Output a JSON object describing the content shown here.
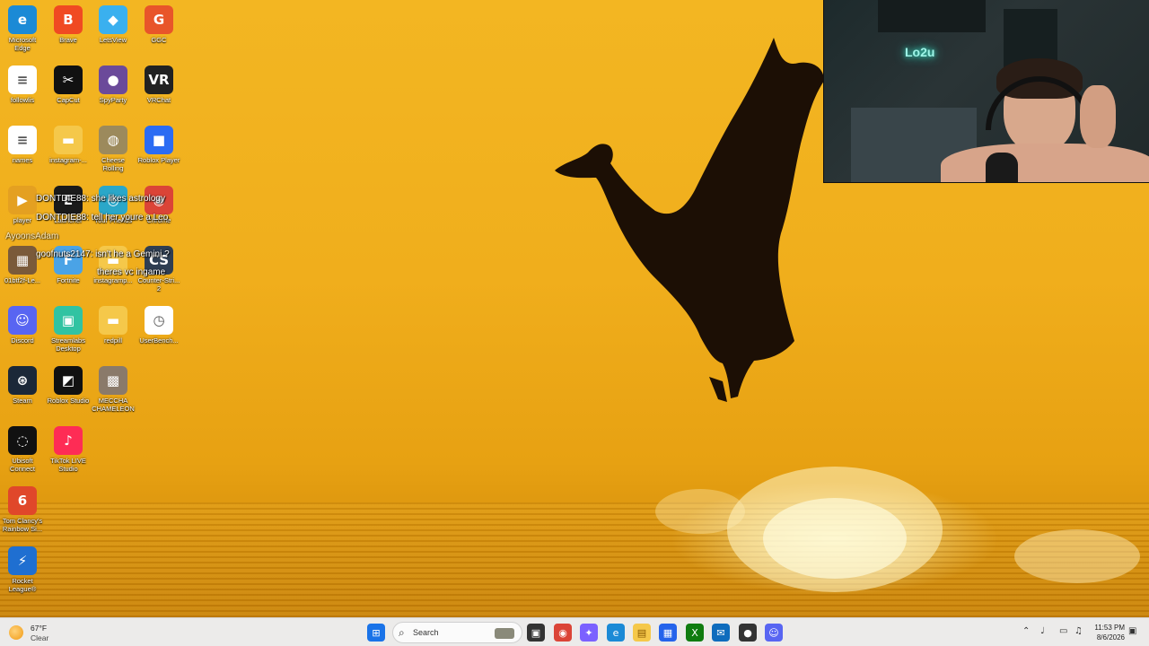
{
  "desktop_icons": [
    {
      "label": "Microsoft Edge",
      "icon": "edge-icon",
      "color": "#1b8ad6"
    },
    {
      "label": "Brave",
      "icon": "brave-icon",
      "color": "#f04a22"
    },
    {
      "label": "LetsView",
      "icon": "letsview-icon",
      "color": "#3ab0ef"
    },
    {
      "label": "GGC",
      "icon": "ggc-icon",
      "color": "#e8552a"
    },
    {
      "label": "followlis",
      "icon": "text-file-icon",
      "color": "#ffffff"
    },
    {
      "label": "CapCut",
      "icon": "capcut-icon",
      "color": "#111111"
    },
    {
      "label": "SpyParty",
      "icon": "spyparty-icon",
      "color": "#6b4a9a"
    },
    {
      "label": "VRChat",
      "icon": "vrchat-icon",
      "color": "#222222"
    },
    {
      "label": "names",
      "icon": "text-file-icon",
      "color": "#ffffff"
    },
    {
      "label": "instagram-...",
      "icon": "folder-icon",
      "color": "#f5c84a"
    },
    {
      "label": "Cheese Rolling",
      "icon": "cheese-rolling-icon",
      "color": "#9c8a5c"
    },
    {
      "label": "Roblox Player",
      "icon": "roblox-icon",
      "color": "#2b6cf3"
    },
    {
      "label": "player",
      "icon": "player-icon",
      "color": "#e4a021"
    },
    {
      "label": "Launcher",
      "icon": "epic-games-icon",
      "color": "#1a1a1a"
    },
    {
      "label": "Your Friends",
      "icon": "your-friends-icon",
      "color": "#2aa7c9"
    },
    {
      "label": "Chrome",
      "icon": "chrome-icon",
      "color": "#db4437"
    },
    {
      "label": "01btf2f-Le...",
      "icon": "image-file-icon",
      "color": "#7a5a3a"
    },
    {
      "label": "Fortnite",
      "icon": "fortnite-icon",
      "color": "#4aa3e6"
    },
    {
      "label": "instagramp...",
      "icon": "folder-icon",
      "color": "#f5c84a"
    },
    {
      "label": "Counter-Stri... 2",
      "icon": "counter-strike-icon",
      "color": "#2f3e52"
    },
    {
      "label": "Discord",
      "icon": "discord-icon",
      "color": "#5865f2"
    },
    {
      "label": "Streamlabs Desktop",
      "icon": "streamlabs-icon",
      "color": "#31c3a2"
    },
    {
      "label": "redpill",
      "icon": "folder-icon",
      "color": "#f5c84a"
    },
    {
      "label": "UserBench...",
      "icon": "userbenchmark-icon",
      "color": "#ffffff"
    },
    {
      "label": "Steam",
      "icon": "steam-icon",
      "color": "#1b2838"
    },
    {
      "label": "Roblox Studio",
      "icon": "roblox-studio-icon",
      "color": "#111111"
    },
    {
      "label": "MECCHA CHAMELEON",
      "icon": "meccha-chameleon-icon",
      "color": "#8a7a6a"
    },
    {
      "label": "Ubisoft Connect",
      "icon": "ubisoft-icon",
      "color": "#111111"
    },
    {
      "label": "TikTok LIVE Studio",
      "icon": "tiktok-icon",
      "color": "#fe2c55"
    },
    {
      "label": "Tom Clancy's Rainbow Si...",
      "icon": "rainbow-six-icon",
      "color": "#e0472a"
    },
    {
      "label": "Rocket League®",
      "icon": "rocket-league-icon",
      "color": "#1f6fd1"
    }
  ],
  "chat": [
    {
      "user": "DONTDIE88:",
      "text": " she likes astrology",
      "dim": false
    },
    {
      "user": "DONTDIE88:",
      "text": " tell her youre a Leo",
      "dim": false
    },
    {
      "user": "AyoonsAdam",
      "text": "",
      "dim": true
    },
    {
      "user": "goofnuts2147:",
      "text": " isn't he a Gemini ?",
      "dim": false
    },
    {
      "user": "",
      "text": "theres vc ingame",
      "dim": false
    }
  ],
  "webcam": {
    "neon_text": "Lo2u"
  },
  "taskbar": {
    "weather_temp": "67°F",
    "weather_cond": "Clear",
    "search_placeholder": "Search",
    "time": "11:53 PM",
    "date": "8/6/2026",
    "apps": [
      {
        "name": "start-button",
        "glyph": "⊞",
        "color": "#1a73e8"
      },
      {
        "name": "task-view",
        "glyph": "▣",
        "color": "#333333"
      },
      {
        "name": "chrome",
        "glyph": "◉",
        "color": "#db4437"
      },
      {
        "name": "copilot",
        "glyph": "✦",
        "color": "#7b61ff"
      },
      {
        "name": "edge",
        "glyph": "e",
        "color": "#1b8ad6"
      },
      {
        "name": "file-explorer",
        "glyph": "▤",
        "color": "#f5c84a"
      },
      {
        "name": "microsoft-store",
        "glyph": "▦",
        "color": "#2563eb"
      },
      {
        "name": "xbox",
        "glyph": "X",
        "color": "#107c10"
      },
      {
        "name": "outlook",
        "glyph": "✉",
        "color": "#0f6cbd"
      },
      {
        "name": "obs",
        "glyph": "●",
        "color": "#333333"
      },
      {
        "name": "discord",
        "glyph": "☺",
        "color": "#5865f2"
      }
    ],
    "tray": [
      {
        "name": "show-hidden-icons",
        "glyph": "⌃"
      },
      {
        "name": "microphone",
        "glyph": "♩"
      },
      {
        "name": "network",
        "glyph": "▭"
      },
      {
        "name": "volume",
        "glyph": "♫"
      }
    ]
  }
}
